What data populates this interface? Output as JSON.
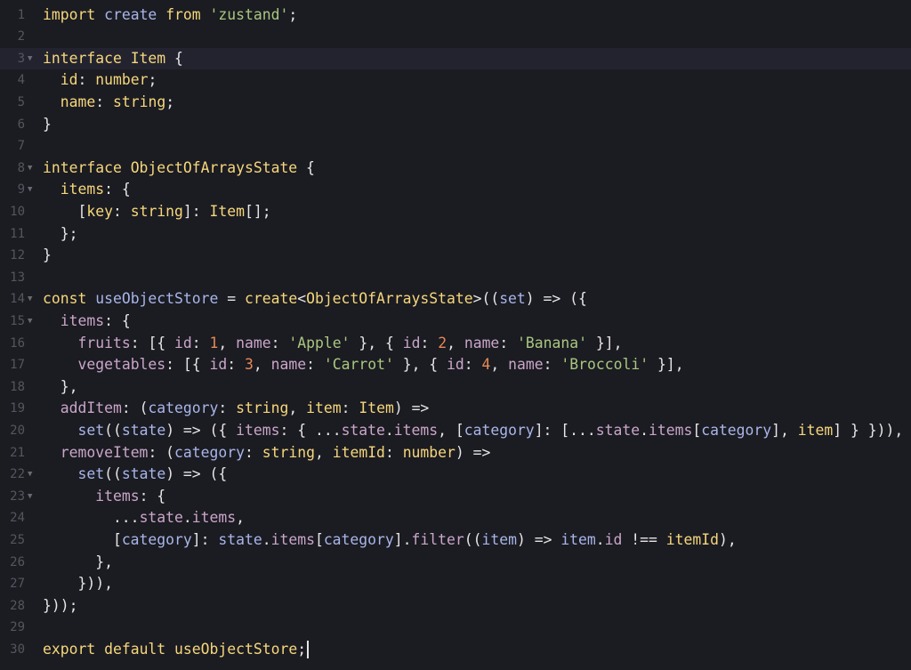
{
  "editor": {
    "cursor_line": 30,
    "active_line": 3,
    "folds": [
      3,
      8,
      9,
      14,
      15,
      22,
      23
    ]
  },
  "lines": [
    {
      "n": "1",
      "tokens": [
        [
          "kw",
          "import"
        ],
        [
          "plain",
          " "
        ],
        [
          "fn",
          "create"
        ],
        [
          "plain",
          " "
        ],
        [
          "kw",
          "from"
        ],
        [
          "plain",
          " "
        ],
        [
          "str",
          "'zustand'"
        ],
        [
          "punc",
          ";"
        ]
      ]
    },
    {
      "n": "2",
      "tokens": []
    },
    {
      "n": "3",
      "tokens": [
        [
          "kw",
          "interface"
        ],
        [
          "plain",
          " "
        ],
        [
          "type",
          "Item"
        ],
        [
          "plain",
          " {"
        ]
      ]
    },
    {
      "n": "4",
      "tokens": [
        [
          "plain",
          "  "
        ],
        [
          "type",
          "id"
        ],
        [
          "plain",
          ": "
        ],
        [
          "type",
          "number"
        ],
        [
          "punc",
          ";"
        ]
      ]
    },
    {
      "n": "5",
      "tokens": [
        [
          "plain",
          "  "
        ],
        [
          "type",
          "name"
        ],
        [
          "plain",
          ": "
        ],
        [
          "type",
          "string"
        ],
        [
          "punc",
          ";"
        ]
      ]
    },
    {
      "n": "6",
      "tokens": [
        [
          "plain",
          "}"
        ]
      ]
    },
    {
      "n": "7",
      "tokens": []
    },
    {
      "n": "8",
      "tokens": [
        [
          "kw",
          "interface"
        ],
        [
          "plain",
          " "
        ],
        [
          "type",
          "ObjectOfArraysState"
        ],
        [
          "plain",
          " {"
        ]
      ]
    },
    {
      "n": "9",
      "tokens": [
        [
          "plain",
          "  "
        ],
        [
          "type",
          "items"
        ],
        [
          "plain",
          ": {"
        ]
      ]
    },
    {
      "n": "10",
      "tokens": [
        [
          "plain",
          "    ["
        ],
        [
          "type",
          "key"
        ],
        [
          "plain",
          ": "
        ],
        [
          "type",
          "string"
        ],
        [
          "plain",
          "]: "
        ],
        [
          "type",
          "Item"
        ],
        [
          "plain",
          "[];"
        ]
      ]
    },
    {
      "n": "11",
      "tokens": [
        [
          "plain",
          "  };"
        ]
      ]
    },
    {
      "n": "12",
      "tokens": [
        [
          "plain",
          "}"
        ]
      ]
    },
    {
      "n": "13",
      "tokens": []
    },
    {
      "n": "14",
      "tokens": [
        [
          "kw",
          "const"
        ],
        [
          "plain",
          " "
        ],
        [
          "fn",
          "useObjectStore"
        ],
        [
          "plain",
          " = "
        ],
        [
          "kw",
          "create"
        ],
        [
          "plain",
          "<"
        ],
        [
          "type",
          "ObjectOfArraysState"
        ],
        [
          "plain",
          ">(("
        ],
        [
          "param",
          "set"
        ],
        [
          "plain",
          ") => ({"
        ]
      ]
    },
    {
      "n": "15",
      "tokens": [
        [
          "plain",
          "  "
        ],
        [
          "prop",
          "items"
        ],
        [
          "plain",
          ": {"
        ]
      ]
    },
    {
      "n": "16",
      "tokens": [
        [
          "plain",
          "    "
        ],
        [
          "prop",
          "fruits"
        ],
        [
          "plain",
          ": [{ "
        ],
        [
          "prop",
          "id"
        ],
        [
          "plain",
          ": "
        ],
        [
          "num-lit",
          "1"
        ],
        [
          "plain",
          ", "
        ],
        [
          "prop",
          "name"
        ],
        [
          "plain",
          ": "
        ],
        [
          "str",
          "'Apple'"
        ],
        [
          "plain",
          " }, { "
        ],
        [
          "prop",
          "id"
        ],
        [
          "plain",
          ": "
        ],
        [
          "num-lit",
          "2"
        ],
        [
          "plain",
          ", "
        ],
        [
          "prop",
          "name"
        ],
        [
          "plain",
          ": "
        ],
        [
          "str",
          "'Banana'"
        ],
        [
          "plain",
          " }],"
        ]
      ]
    },
    {
      "n": "17",
      "tokens": [
        [
          "plain",
          "    "
        ],
        [
          "prop",
          "vegetables"
        ],
        [
          "plain",
          ": [{ "
        ],
        [
          "prop",
          "id"
        ],
        [
          "plain",
          ": "
        ],
        [
          "num-lit",
          "3"
        ],
        [
          "plain",
          ", "
        ],
        [
          "prop",
          "name"
        ],
        [
          "plain",
          ": "
        ],
        [
          "str",
          "'Carrot'"
        ],
        [
          "plain",
          " }, { "
        ],
        [
          "prop",
          "id"
        ],
        [
          "plain",
          ": "
        ],
        [
          "num-lit",
          "4"
        ],
        [
          "plain",
          ", "
        ],
        [
          "prop",
          "name"
        ],
        [
          "plain",
          ": "
        ],
        [
          "str",
          "'Broccoli'"
        ],
        [
          "plain",
          " }],"
        ]
      ]
    },
    {
      "n": "18",
      "tokens": [
        [
          "plain",
          "  },"
        ]
      ]
    },
    {
      "n": "19",
      "tokens": [
        [
          "plain",
          "  "
        ],
        [
          "prop",
          "addItem"
        ],
        [
          "plain",
          ": ("
        ],
        [
          "param",
          "category"
        ],
        [
          "plain",
          ": "
        ],
        [
          "type",
          "string"
        ],
        [
          "plain",
          ", "
        ],
        [
          "type",
          "item"
        ],
        [
          "plain",
          ": "
        ],
        [
          "type",
          "Item"
        ],
        [
          "plain",
          ") =>"
        ]
      ]
    },
    {
      "n": "20",
      "tokens": [
        [
          "plain",
          "    "
        ],
        [
          "fn",
          "set"
        ],
        [
          "plain",
          "(("
        ],
        [
          "param",
          "state"
        ],
        [
          "plain",
          ") => ({ "
        ],
        [
          "prop",
          "items"
        ],
        [
          "plain",
          ": { ..."
        ],
        [
          "prop",
          "state"
        ],
        [
          "plain",
          "."
        ],
        [
          "prop",
          "items"
        ],
        [
          "plain",
          ", ["
        ],
        [
          "param",
          "category"
        ],
        [
          "plain",
          "]: [..."
        ],
        [
          "prop",
          "state"
        ],
        [
          "plain",
          "."
        ],
        [
          "prop",
          "items"
        ],
        [
          "plain",
          "["
        ],
        [
          "param",
          "category"
        ],
        [
          "plain",
          "], "
        ],
        [
          "type",
          "item"
        ],
        [
          "plain",
          "] } })),"
        ]
      ]
    },
    {
      "n": "21",
      "tokens": [
        [
          "plain",
          "  "
        ],
        [
          "prop",
          "removeItem"
        ],
        [
          "plain",
          ": ("
        ],
        [
          "param",
          "category"
        ],
        [
          "plain",
          ": "
        ],
        [
          "type",
          "string"
        ],
        [
          "plain",
          ", "
        ],
        [
          "type",
          "itemId"
        ],
        [
          "plain",
          ": "
        ],
        [
          "type",
          "number"
        ],
        [
          "plain",
          ") =>"
        ]
      ]
    },
    {
      "n": "22",
      "tokens": [
        [
          "plain",
          "    "
        ],
        [
          "fn",
          "set"
        ],
        [
          "plain",
          "(("
        ],
        [
          "param",
          "state"
        ],
        [
          "plain",
          ") => ({"
        ]
      ]
    },
    {
      "n": "23",
      "tokens": [
        [
          "plain",
          "      "
        ],
        [
          "prop",
          "items"
        ],
        [
          "plain",
          ": {"
        ]
      ]
    },
    {
      "n": "24",
      "tokens": [
        [
          "plain",
          "        ..."
        ],
        [
          "prop",
          "state"
        ],
        [
          "plain",
          "."
        ],
        [
          "prop",
          "items"
        ],
        [
          "plain",
          ","
        ]
      ]
    },
    {
      "n": "25",
      "tokens": [
        [
          "plain",
          "        ["
        ],
        [
          "param",
          "category"
        ],
        [
          "plain",
          "]: "
        ],
        [
          "fn",
          "state"
        ],
        [
          "plain",
          "."
        ],
        [
          "prop",
          "items"
        ],
        [
          "plain",
          "["
        ],
        [
          "param",
          "category"
        ],
        [
          "plain",
          "]."
        ],
        [
          "prop",
          "filter"
        ],
        [
          "plain",
          "(("
        ],
        [
          "param",
          "item"
        ],
        [
          "plain",
          ") => "
        ],
        [
          "fn",
          "item"
        ],
        [
          "plain",
          "."
        ],
        [
          "prop",
          "id"
        ],
        [
          "plain",
          " !== "
        ],
        [
          "type",
          "itemId"
        ],
        [
          "plain",
          "),"
        ]
      ]
    },
    {
      "n": "26",
      "tokens": [
        [
          "plain",
          "      },"
        ]
      ]
    },
    {
      "n": "27",
      "tokens": [
        [
          "plain",
          "    })),"
        ]
      ]
    },
    {
      "n": "28",
      "tokens": [
        [
          "plain",
          "}));"
        ]
      ]
    },
    {
      "n": "29",
      "tokens": []
    },
    {
      "n": "30",
      "tokens": [
        [
          "kw",
          "export"
        ],
        [
          "plain",
          " "
        ],
        [
          "kw",
          "default"
        ],
        [
          "plain",
          " "
        ],
        [
          "type",
          "useObjectStore"
        ],
        [
          "punc",
          ";"
        ]
      ]
    }
  ]
}
